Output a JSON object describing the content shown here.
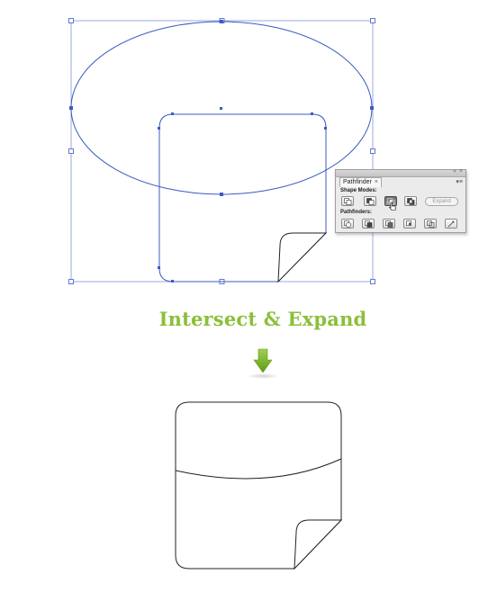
{
  "panel": {
    "tab_label": "Pathfinder",
    "tab_close": "×",
    "window_close": "×",
    "collapse": "«",
    "menu": "▾≡",
    "shape_modes_label": "Shape Modes:",
    "shape_modes": [
      {
        "name": "unite",
        "icon": "unite-icon",
        "active": false
      },
      {
        "name": "minus-front",
        "icon": "minus-front-icon",
        "active": false
      },
      {
        "name": "intersect",
        "icon": "intersect-icon",
        "active": true
      },
      {
        "name": "exclude",
        "icon": "exclude-icon",
        "active": false
      }
    ],
    "expand_label": "Expand",
    "pathfinders_label": "Pathfinders:",
    "pathfinders": [
      {
        "name": "divide",
        "icon": "divide-icon"
      },
      {
        "name": "trim",
        "icon": "trim-icon"
      },
      {
        "name": "merge",
        "icon": "merge-icon"
      },
      {
        "name": "crop",
        "icon": "crop-icon"
      },
      {
        "name": "outline",
        "icon": "outline-icon"
      },
      {
        "name": "minus-back",
        "icon": "minus-back-icon"
      }
    ]
  },
  "caption": "Intersect & Expand",
  "colors": {
    "selection": "#3b5bc4",
    "caption": "#8bbf3a",
    "arrow": "#7ab32e",
    "outline": "#222222"
  }
}
